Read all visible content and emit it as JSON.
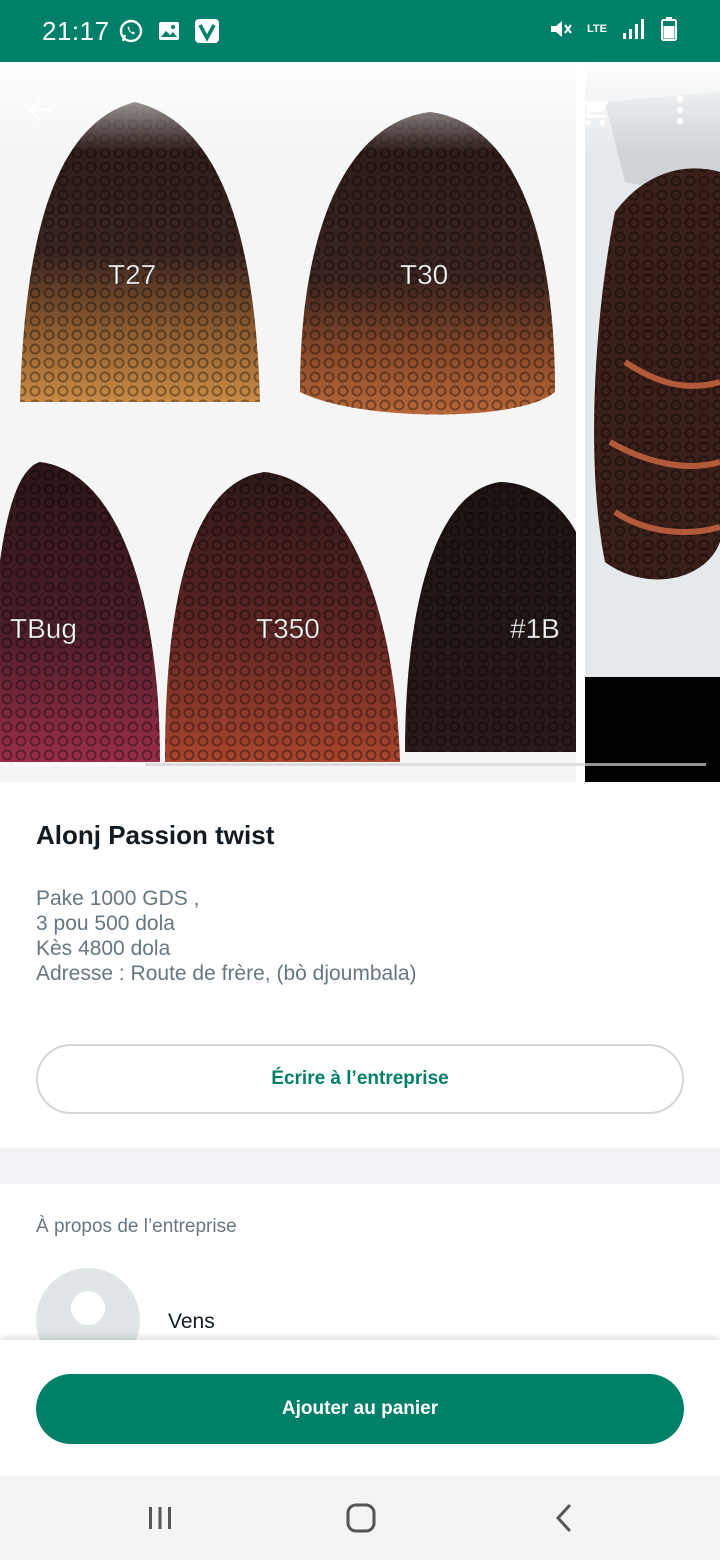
{
  "status_bar": {
    "time": "21:17",
    "left_icons": [
      "whatsapp-icon",
      "gallery-icon",
      "v-app-icon"
    ],
    "right_icons": [
      "mute-icon",
      "lte-icon",
      "signal-icon",
      "battery-icon"
    ],
    "lte_label": "LTE"
  },
  "gallery": {
    "image_labels": [
      "T27",
      "T30",
      "TBug",
      "T350",
      "#1B"
    ],
    "progress": 0.19
  },
  "product": {
    "title": "Alonj Passion twist",
    "description": [
      "Pake 1000 GDS ,",
      "3 pou 500 dola",
      "Kès 4800 dola",
      "Adresse : Route de frère, (bò djoumbala)"
    ],
    "write_button": "Écrire à l’entreprise"
  },
  "about": {
    "label": "À propos de l’entreprise",
    "business_name": "Vens"
  },
  "bottom": {
    "add_to_cart": "Ajouter au panier"
  },
  "colors": {
    "brand": "#008069",
    "secondary_text": "#667781",
    "divider": "#f0f2f5"
  }
}
